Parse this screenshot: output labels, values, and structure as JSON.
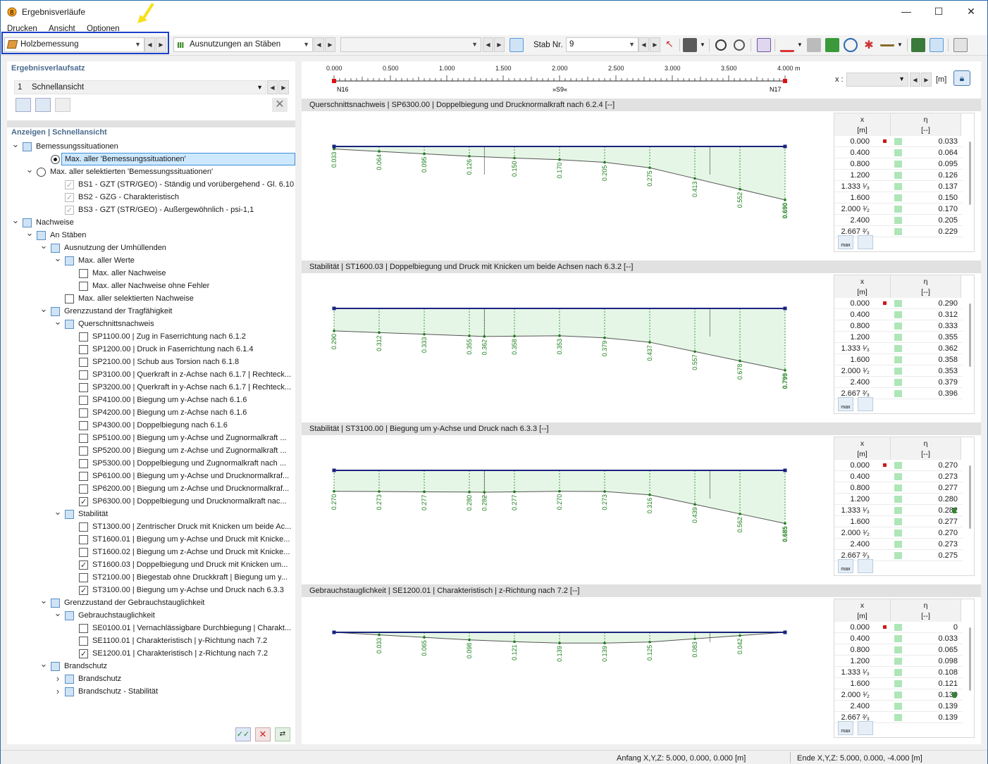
{
  "window": {
    "title": "Ergebnisverläufe"
  },
  "menu": [
    "Drucken",
    "Ansicht",
    "Optionen"
  ],
  "toolbar": {
    "module": "Holzbemessung",
    "result_type": "Ausnutzungen an Stäben",
    "empty_combo": "",
    "stab_label": "Stab Nr.",
    "stab_value": "9"
  },
  "left": {
    "set_header": "Ergebnisverlaufsatz",
    "set_number": "1",
    "set_name": "Schnellansicht",
    "show_header": "Anzeigen | Schnellansicht",
    "tree": [
      {
        "label": "Bemessungssituationen"
      },
      {
        "label": "Max. aller 'Bemessungssituationen'"
      },
      {
        "label": "Max. aller selektierten 'Bemessungssituationen'"
      },
      {
        "label": "BS1 - GZT (STR/GEO) - Ständig und vorübergehend - Gl. 6.10"
      },
      {
        "label": "BS2 - GZG - Charakteristisch"
      },
      {
        "label": "BS3 - GZT (STR/GEO) - Außergewöhnlich - psi-1,1"
      },
      {
        "label": "Nachweise"
      },
      {
        "label": "An Stäben"
      },
      {
        "label": "Ausnutzung der Umhüllenden"
      },
      {
        "label": "Max. aller Werte"
      },
      {
        "label": "Max. aller Nachweise"
      },
      {
        "label": "Max. aller Nachweise ohne Fehler"
      },
      {
        "label": "Max. aller selektierten Nachweise"
      },
      {
        "label": "Grenzzustand der Tragfähigkeit"
      },
      {
        "label": "Querschnittsnachweis"
      },
      {
        "label": "SP1100.00 | Zug in Faserrichtung nach 6.1.2"
      },
      {
        "label": "SP1200.00 | Druck in Faserrichtung nach 6.1.4"
      },
      {
        "label": "SP2100.00 | Schub aus Torsion nach 6.1.8"
      },
      {
        "label": "SP3100.00 | Querkraft in z-Achse nach 6.1.7 | Rechteck..."
      },
      {
        "label": "SP3200.00 | Querkraft in y-Achse nach 6.1.7 | Rechteck..."
      },
      {
        "label": "SP4100.00 | Biegung um y-Achse nach 6.1.6"
      },
      {
        "label": "SP4200.00 | Biegung um z-Achse nach 6.1.6"
      },
      {
        "label": "SP4300.00 | Doppelbiegung nach 6.1.6"
      },
      {
        "label": "SP5100.00 | Biegung um y-Achse und Zugnormalkraft ..."
      },
      {
        "label": "SP5200.00 | Biegung um z-Achse und Zugnormalkraft ..."
      },
      {
        "label": "SP5300.00 | Doppelbiegung und Zugnormalkraft nach ..."
      },
      {
        "label": "SP6100.00 | Biegung um y-Achse und Drucknormalkraf..."
      },
      {
        "label": "SP6200.00 | Biegung um z-Achse und Drucknormalkraf..."
      },
      {
        "label": "SP6300.00 | Doppelbiegung und Drucknormalkraft nac..."
      },
      {
        "label": "Stabilität"
      },
      {
        "label": "ST1300.00 | Zentrischer Druck mit Knicken um beide Ac..."
      },
      {
        "label": "ST1600.01 | Biegung um y-Achse und Druck mit Knicke..."
      },
      {
        "label": "ST1600.02 | Biegung um z-Achse und Druck mit Knicke..."
      },
      {
        "label": "ST1600.03 | Doppelbiegung und Druck mit Knicken um..."
      },
      {
        "label": "ST2100.00 | Biegestab ohne Druckkraft | Biegung um y..."
      },
      {
        "label": "ST3100.00 | Biegung um y-Achse und Druck nach 6.3.3"
      },
      {
        "label": "Grenzzustand der Gebrauchstauglichkeit"
      },
      {
        "label": "Gebrauchstauglichkeit"
      },
      {
        "label": "SE0100.01 | Vernachlässigbare Durchbiegung | Charakt..."
      },
      {
        "label": "SE1100.01 | Charakteristisch | y-Richtung nach 7.2"
      },
      {
        "label": "SE1200.01 | Charakteristisch | z-Richtung nach 7.2"
      },
      {
        "label": "Brandschutz"
      },
      {
        "label": "Brandschutz"
      },
      {
        "label": "Brandschutz - Stabilität"
      }
    ]
  },
  "ruler": {
    "ticks": [
      "0.000",
      "0.500",
      "1.000",
      "1.500",
      "2.000",
      "2.500",
      "3.000",
      "3.500",
      "4.000 m"
    ],
    "start_node": "N16",
    "mid_label": "»S9«",
    "end_node": "N17",
    "x_label": "x :",
    "unit": "[m]"
  },
  "table_headers": {
    "x": "x",
    "x_unit": "[m]",
    "eta": "η",
    "eta_unit": "[--]",
    "max": "max"
  },
  "panels": [
    {
      "title": "Querschnittsnachweis | SP6300.00 | Doppelbiegung und Drucknormalkraft nach 6.2.4 [--]",
      "labels": [
        "0.033",
        "0.064",
        "0.095",
        "0.126",
        "0.150",
        "0.170",
        "0.205",
        "0.275",
        "0.413",
        "0.552",
        "0.690"
      ],
      "rows": [
        [
          "0.000",
          "0.033"
        ],
        [
          "0.400",
          "0.064"
        ],
        [
          "0.800",
          "0.095"
        ],
        [
          "1.200",
          "0.126"
        ],
        [
          "1.333 ¹⁄₃",
          "0.137"
        ],
        [
          "1.600",
          "0.150"
        ],
        [
          "2.000 ¹⁄₂",
          "0.170"
        ],
        [
          "2.400",
          "0.205"
        ],
        [
          "2.667 ²⁄₃",
          "0.229"
        ]
      ]
    },
    {
      "title": "Stabilität | ST1600.03 | Doppelbiegung und Druck mit Knicken um beide Achsen nach 6.3.2 [--]",
      "labels": [
        "0.290",
        "0.312",
        "0.333",
        "0.355",
        "0.362",
        "0.358",
        "0.353",
        "0.379",
        "0.437",
        "0.557",
        "0.678",
        "0.799"
      ],
      "rows": [
        [
          "0.000",
          "0.290"
        ],
        [
          "0.400",
          "0.312"
        ],
        [
          "0.800",
          "0.333"
        ],
        [
          "1.200",
          "0.355"
        ],
        [
          "1.333 ¹⁄₃",
          "0.362"
        ],
        [
          "1.600",
          "0.358"
        ],
        [
          "2.000 ¹⁄₂",
          "0.353"
        ],
        [
          "2.400",
          "0.379"
        ],
        [
          "2.667 ²⁄₃",
          "0.396"
        ]
      ]
    },
    {
      "title": "Stabilität | ST3100.00 | Biegung um y-Achse und Druck nach 6.3.3 [--]",
      "labels": [
        "0.270",
        "0.273",
        "0.277",
        "0.280",
        "0.282",
        "0.277",
        "0.270",
        "0.273",
        "0.316",
        "0.439",
        "0.562",
        "0.685"
      ],
      "rows": [
        [
          "0.000",
          "0.270"
        ],
        [
          "0.400",
          "0.273"
        ],
        [
          "0.800",
          "0.277"
        ],
        [
          "1.200",
          "0.280"
        ],
        [
          "1.333 ¹⁄₃",
          "0.282"
        ],
        [
          "1.600",
          "0.277"
        ],
        [
          "2.000 ¹⁄₂",
          "0.270"
        ],
        [
          "2.400",
          "0.273"
        ],
        [
          "2.667 ²⁄₃",
          "0.275"
        ]
      ]
    },
    {
      "title": "Gebrauchstauglichkeit | SE1200.01 | Charakteristisch | z-Richtung nach 7.2 [--]",
      "labels": [
        "0.033",
        "0.065",
        "0.098",
        "0.121",
        "0.139",
        "0.139",
        "0.125",
        "0.083",
        "0.042"
      ],
      "rows": [
        [
          "0.000",
          "0"
        ],
        [
          "0.400",
          "0.033"
        ],
        [
          "0.800",
          "0.065"
        ],
        [
          "1.200",
          "0.098"
        ],
        [
          "1.333 ¹⁄₃",
          "0.108"
        ],
        [
          "1.600",
          "0.121"
        ],
        [
          "2.000 ¹⁄₂",
          "0.139"
        ],
        [
          "2.400",
          "0.139"
        ],
        [
          "2.667 ²⁄₃",
          "0.139"
        ]
      ]
    }
  ],
  "status": {
    "start": "Anfang X,Y,Z: 5.000, 0.000, 0.000 [m]",
    "end": "Ende X,Y,Z: 5.000, 0.000, -4.000 [m]"
  },
  "colors": {
    "accent": "#1a3fc9",
    "fill": "#e6f6e6",
    "label": "#1a7f1a",
    "beam": "#1a237e"
  }
}
